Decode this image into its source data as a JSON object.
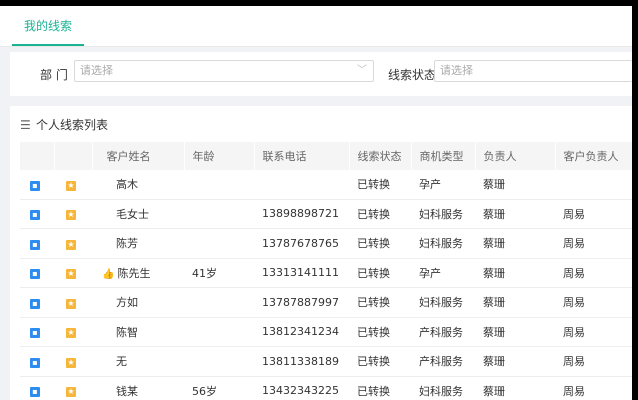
{
  "tab": {
    "label": "我的线索"
  },
  "filter": {
    "dept_label": "部 门",
    "dept_placeholder": "请选择",
    "status_label": "线索状态",
    "status_placeholder": "请选择"
  },
  "list": {
    "title": "个人线索列表",
    "columns": [
      "客户姓名",
      "年龄",
      "联系电话",
      "线索状态",
      "商机类型",
      "负责人",
      "客户负责人"
    ],
    "rows": [
      {
        "name": "高木",
        "liked": false,
        "age": "",
        "phone": "",
        "status": "已转换",
        "type": "孕产",
        "owner": "蔡珊",
        "client_owner": ""
      },
      {
        "name": "毛女士",
        "liked": false,
        "age": "",
        "phone": "13898898721",
        "status": "已转换",
        "type": "妇科服务",
        "owner": "蔡珊",
        "client_owner": "周易"
      },
      {
        "name": "陈芳",
        "liked": false,
        "age": "",
        "phone": "13787678765",
        "status": "已转换",
        "type": "妇科服务",
        "owner": "蔡珊",
        "client_owner": "周易"
      },
      {
        "name": "陈先生",
        "liked": true,
        "age": "41岁",
        "phone": "13313141111",
        "status": "已转换",
        "type": "孕产",
        "owner": "蔡珊",
        "client_owner": "周易"
      },
      {
        "name": "方如",
        "liked": false,
        "age": "",
        "phone": "13787887997",
        "status": "已转换",
        "type": "妇科服务",
        "owner": "蔡珊",
        "client_owner": "周易"
      },
      {
        "name": "陈智",
        "liked": false,
        "age": "",
        "phone": "13812341234",
        "status": "已转换",
        "type": "产科服务",
        "owner": "蔡珊",
        "client_owner": "周易"
      },
      {
        "name": "无",
        "liked": false,
        "age": "",
        "phone": "13811338189",
        "status": "已转换",
        "type": "产科服务",
        "owner": "蔡珊",
        "client_owner": "周易"
      },
      {
        "name": "钱某",
        "liked": false,
        "age": "56岁",
        "phone": "13432343225",
        "status": "已转换",
        "type": "妇科服务",
        "owner": "蔡珊",
        "client_owner": "周易"
      }
    ]
  }
}
